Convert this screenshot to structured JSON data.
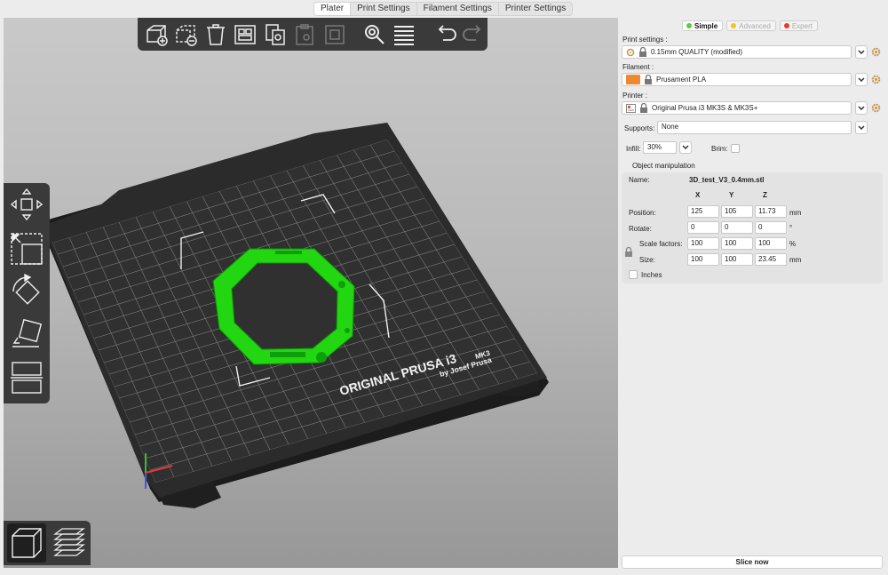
{
  "tabs": [
    {
      "label": "Plater",
      "active": true
    },
    {
      "label": "Print Settings",
      "active": false
    },
    {
      "label": "Filament Settings",
      "active": false
    },
    {
      "label": "Printer Settings",
      "active": false
    }
  ],
  "toolbar": {
    "icons": [
      "add-icon",
      "delete-icon",
      "delete-all-icon",
      "arrange-icon",
      "copy-icon",
      "paste-icon",
      "instance-add-icon",
      "search-icon",
      "layers-icon",
      "undo-icon",
      "redo-icon"
    ]
  },
  "bed": {
    "brand_line1": "ORIGINAL PRUSA i3",
    "brand_model": "MK3",
    "brand_line2": "by Josef Prusa"
  },
  "colors": {
    "accent": "#ec8a34",
    "model": "#22d611",
    "simple_dot": "#59d036",
    "advanced_dot": "#f5c518",
    "expert_dot": "#e53c2e",
    "bed": "#2b2b2b"
  },
  "modes": {
    "simple": "Simple",
    "advanced": "Advanced",
    "expert": "Expert"
  },
  "print_settings": {
    "label": "Print settings :",
    "value": "0.15mm QUALITY (modified)"
  },
  "filament": {
    "label": "Filament :",
    "value": "Prusament PLA"
  },
  "printer": {
    "label": "Printer :",
    "value": "Original Prusa i3 MK3S & MK3S+"
  },
  "supports": {
    "label": "Supports:",
    "value": "None"
  },
  "infill": {
    "label": "Infill:",
    "value": "30%"
  },
  "brim": {
    "label": "Brim:",
    "checked": false
  },
  "object_manipulation": {
    "title": "Object manipulation",
    "name_label": "Name:",
    "name_value": "3D_test_V3_0.4mm.stl",
    "axes": [
      "X",
      "Y",
      "Z"
    ],
    "position": {
      "label": "Position:",
      "values": [
        "125",
        "105",
        "11.73"
      ],
      "unit": "mm"
    },
    "rotate": {
      "label": "Rotate:",
      "values": [
        "0",
        "0",
        "0"
      ],
      "unit": "°"
    },
    "scale": {
      "label": "Scale factors:",
      "values": [
        "100",
        "100",
        "100"
      ],
      "unit": "%"
    },
    "size": {
      "label": "Size:",
      "values": [
        "100",
        "100",
        "23.45"
      ],
      "unit": "mm"
    },
    "inches_label": "Inches"
  },
  "slice_button": "Slice now"
}
